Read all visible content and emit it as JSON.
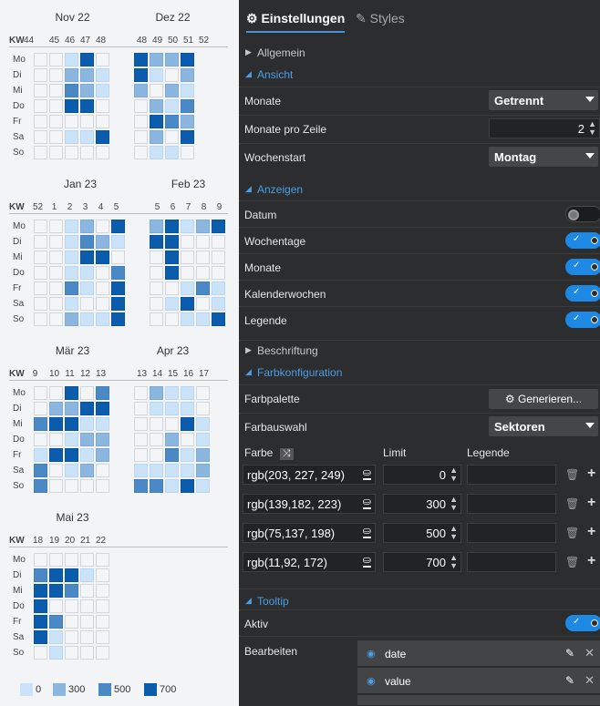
{
  "calendar": {
    "day_labels": [
      "Mo",
      "Di",
      "Mi",
      "Do",
      "Fr",
      "Sa",
      "So"
    ],
    "kw_label": "KW",
    "blocks": [
      {
        "months": [
          {
            "title": "Nov 22"
          },
          {
            "title": "Dez 22"
          }
        ],
        "weeks": [
          "44",
          "45",
          "46",
          "47",
          "48",
          "48",
          "49",
          "50",
          "51",
          "52"
        ],
        "grid": [
          [
            0,
            0,
            1,
            4,
            0,
            4,
            2,
            2,
            4
          ],
          [
            0,
            0,
            2,
            2,
            1,
            4,
            1,
            0,
            2
          ],
          [
            0,
            0,
            3,
            2,
            1,
            2,
            0,
            2,
            1
          ],
          [
            0,
            0,
            4,
            4,
            0,
            0,
            2,
            1,
            3
          ],
          [
            0,
            0,
            0,
            0,
            0,
            0,
            4,
            3,
            2
          ],
          [
            0,
            0,
            1,
            1,
            4,
            0,
            2,
            0,
            4
          ],
          [
            0,
            0,
            0,
            0,
            0,
            0,
            1,
            1,
            0
          ]
        ]
      },
      {
        "months": [
          {
            "title": "Jan 23"
          },
          {
            "title": "Feb 23"
          }
        ],
        "weeks": [
          "52",
          "1",
          "2",
          "3",
          "4",
          "5",
          "5",
          "6",
          "7",
          "8",
          "9"
        ],
        "grid": [
          [
            0,
            0,
            1,
            2,
            0,
            4,
            2,
            4,
            1,
            2,
            4
          ],
          [
            0,
            0,
            1,
            3,
            2,
            1,
            4,
            4,
            0,
            0,
            0
          ],
          [
            0,
            0,
            1,
            4,
            4,
            0,
            0,
            4,
            0,
            0,
            0
          ],
          [
            0,
            0,
            1,
            1,
            0,
            3,
            0,
            4,
            0,
            0,
            0
          ],
          [
            0,
            0,
            3,
            1,
            0,
            4,
            0,
            0,
            1,
            3,
            1
          ],
          [
            0,
            0,
            1,
            0,
            0,
            4,
            0,
            1,
            4,
            0,
            1
          ],
          [
            0,
            0,
            2,
            1,
            1,
            4,
            0,
            0,
            1,
            1,
            4
          ]
        ]
      },
      {
        "months": [
          {
            "title": "Mär 23"
          },
          {
            "title": "Apr 23"
          }
        ],
        "weeks": [
          "9",
          "10",
          "11",
          "12",
          "13",
          "13",
          "14",
          "15",
          "16",
          "17"
        ],
        "grid": [
          [
            0,
            0,
            4,
            0,
            3,
            0,
            2,
            1,
            1,
            0
          ],
          [
            0,
            2,
            2,
            4,
            4,
            0,
            1,
            1,
            1,
            0
          ],
          [
            3,
            4,
            4,
            1,
            1,
            0,
            0,
            0,
            4,
            1
          ],
          [
            0,
            0,
            1,
            2,
            2,
            0,
            0,
            2,
            0,
            1
          ],
          [
            1,
            4,
            4,
            1,
            2,
            0,
            0,
            3,
            1,
            2
          ],
          [
            3,
            0,
            1,
            2,
            0,
            1,
            1,
            1,
            1,
            2
          ],
          [
            3,
            0,
            0,
            0,
            0,
            3,
            3,
            1,
            4,
            1
          ]
        ]
      },
      {
        "months": [
          {
            "title": "Mai 23"
          }
        ],
        "weeks": [
          "18",
          "19",
          "20",
          "21",
          "22"
        ],
        "grid": [
          [
            0,
            0,
            0,
            0,
            0
          ],
          [
            3,
            4,
            4,
            1,
            0
          ],
          [
            4,
            4,
            3,
            0,
            0
          ],
          [
            4,
            0,
            0,
            0,
            0
          ],
          [
            4,
            3,
            0,
            0,
            0
          ],
          [
            4,
            1,
            0,
            0,
            0
          ],
          [
            0,
            1,
            0,
            0,
            0
          ]
        ]
      }
    ],
    "legend": [
      {
        "label": "0",
        "color": "#cbe3f9"
      },
      {
        "label": "300",
        "color": "#8bb6df"
      },
      {
        "label": "500",
        "color": "#4b89c6"
      },
      {
        "label": "700",
        "color": "#0b5cac"
      }
    ]
  },
  "panel": {
    "tabs": {
      "settings": "Einstellungen",
      "styles": "Styles"
    },
    "sections": {
      "allgemein": "Allgemein",
      "ansicht": "Ansicht",
      "anzeigen": "Anzeigen",
      "beschriftung": "Beschriftung",
      "farbkonfiguration": "Farbkonfiguration",
      "tooltip": "Tooltip"
    },
    "ansicht": {
      "monate_label": "Monate",
      "monate_value": "Getrennt",
      "monate_pro_zeile_label": "Monate pro Zeile",
      "monate_pro_zeile_value": "2",
      "wochenstart_label": "Wochenstart",
      "wochenstart_value": "Montag"
    },
    "anzeigen": {
      "datum": "Datum",
      "datum_on": false,
      "wochentage": "Wochentage",
      "wochentage_on": true,
      "monate": "Monate",
      "monate_on": true,
      "kalenderwochen": "Kalenderwochen",
      "kalenderwochen_on": true,
      "legende": "Legende",
      "legende_on": true
    },
    "farbkonfiguration": {
      "farbpalette_label": "Farbpalette",
      "generieren_label": "Generieren...",
      "farbauswahl_label": "Farbauswahl",
      "farbauswahl_value": "Sektoren",
      "col_farbe": "Farbe",
      "col_limit": "Limit",
      "col_legende": "Legende",
      "rows": [
        {
          "color": "rgb(203, 227, 249)",
          "limit": "0"
        },
        {
          "color": "rgb(139,182, 223)",
          "limit": "300"
        },
        {
          "color": "rgb(75,137, 198)",
          "limit": "500"
        },
        {
          "color": "rgb(11,92, 172)",
          "limit": "700"
        }
      ]
    },
    "tooltip": {
      "aktiv_label": "Aktiv",
      "aktiv_on": true,
      "bearbeiten_label": "Bearbeiten",
      "fields": [
        {
          "label": "date"
        },
        {
          "label": "value"
        }
      ]
    }
  }
}
